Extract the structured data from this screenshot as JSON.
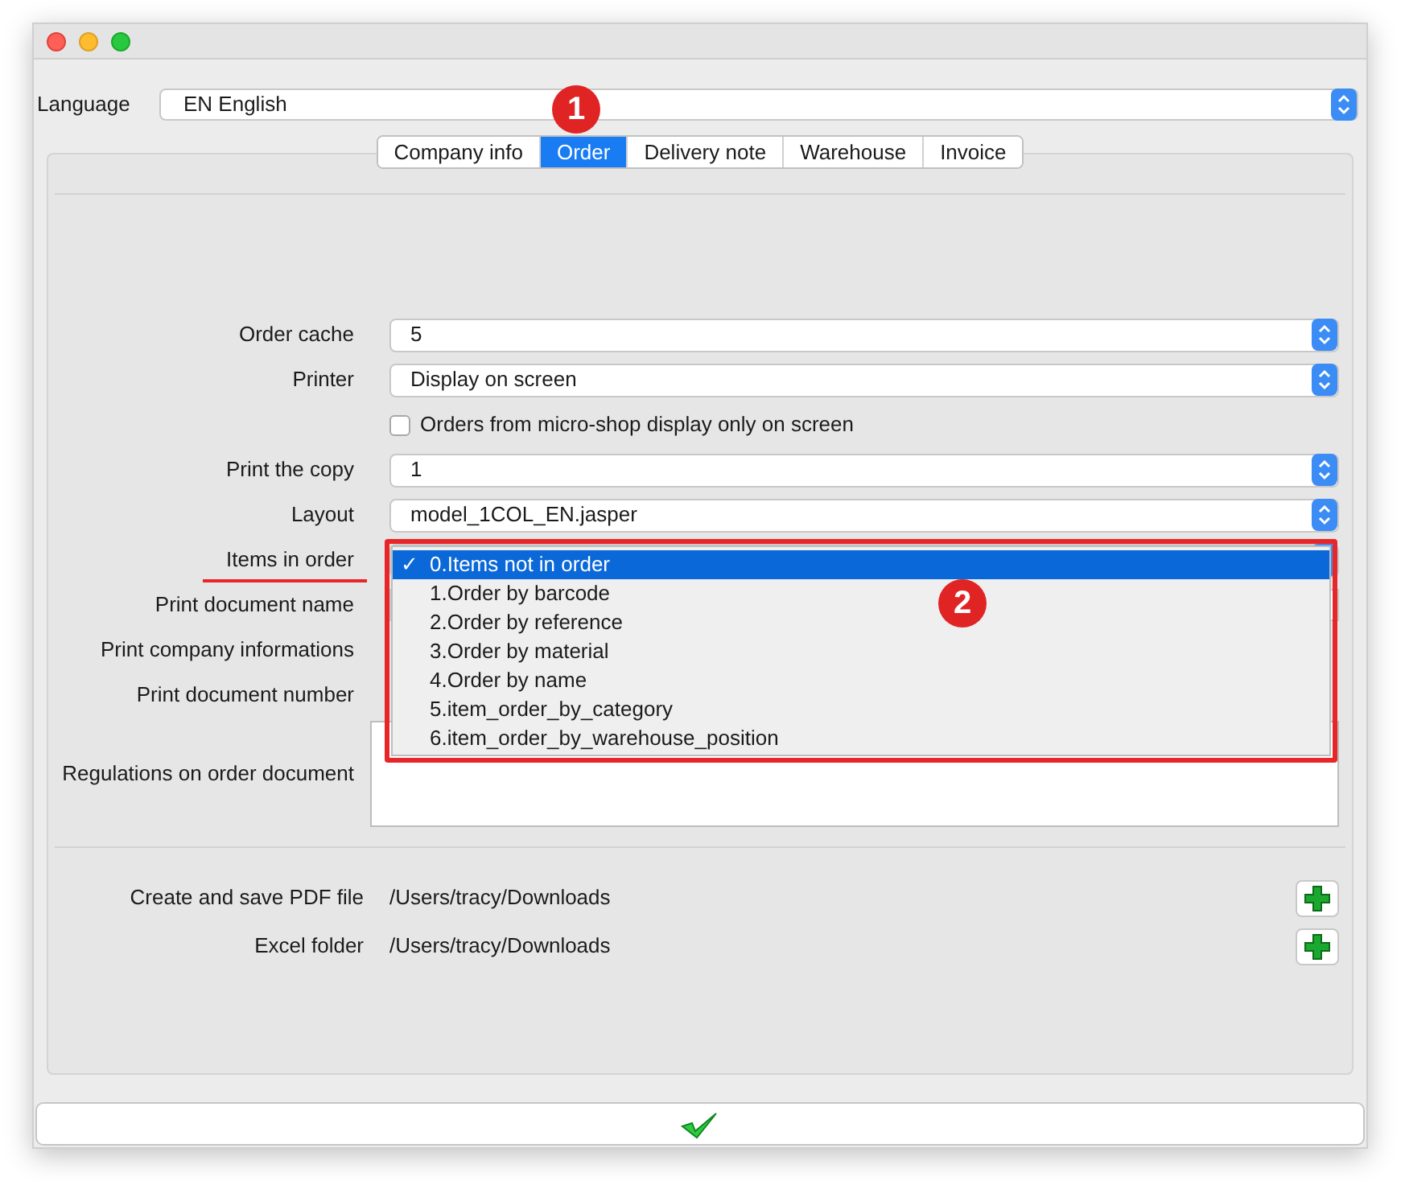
{
  "language": {
    "label": "Language",
    "value": "EN English"
  },
  "tabs": [
    {
      "label": "Company info",
      "selected": false
    },
    {
      "label": "Order",
      "selected": true
    },
    {
      "label": "Delivery note",
      "selected": false
    },
    {
      "label": "Warehouse",
      "selected": false
    },
    {
      "label": "Invoice",
      "selected": false
    }
  ],
  "form": [
    {
      "kind": "combo",
      "label": "Order cache",
      "value": "5"
    },
    {
      "kind": "combo",
      "label": "Printer",
      "value": "Display on screen"
    },
    {
      "kind": "checkbox",
      "label": "Orders from micro-shop display only on screen",
      "checked": false
    },
    {
      "kind": "combo",
      "label": "Print the copy",
      "value": "1"
    },
    {
      "kind": "combo",
      "label": "Layout",
      "value": "model_1COL_EN.jasper"
    },
    {
      "kind": "open_combo",
      "label": "Items in order",
      "underlined": true
    },
    {
      "kind": "field",
      "label": "Print document name"
    },
    {
      "kind": "label",
      "label": "Print company informations"
    },
    {
      "kind": "label",
      "label": "Print document number"
    },
    {
      "kind": "textarea",
      "label": "Regulations on order document"
    }
  ],
  "dropdown": {
    "options": [
      {
        "label": "0.Items not in order",
        "selected": true
      },
      {
        "label": "1.Order by barcode",
        "selected": false
      },
      {
        "label": "2.Order by reference",
        "selected": false
      },
      {
        "label": "3.Order by material",
        "selected": false
      },
      {
        "label": "4.Order by name",
        "selected": false
      },
      {
        "label": "5.item_order_by_category",
        "selected": false
      },
      {
        "label": "6.item_order_by_warehouse_position",
        "selected": false
      }
    ],
    "check_mark": "✓"
  },
  "folders": [
    {
      "label": "Create and save PDF file",
      "path": "/Users/tracy/Downloads"
    },
    {
      "label": "Excel folder",
      "path": "/Users/tracy/Downloads"
    }
  ],
  "annotations": [
    {
      "label": "1"
    },
    {
      "label": "2"
    }
  ]
}
